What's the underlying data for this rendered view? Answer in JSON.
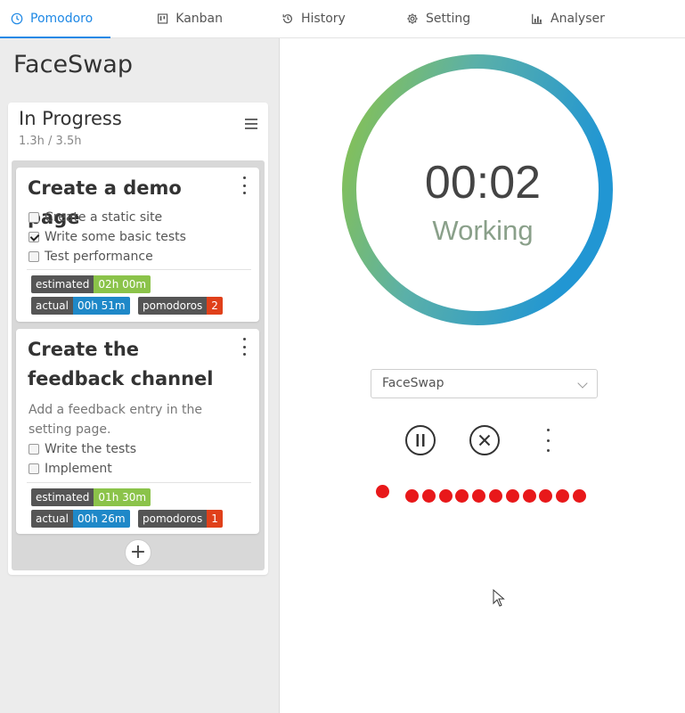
{
  "tabs": [
    {
      "label": "Pomodoro",
      "icon": "clock-icon",
      "active": true
    },
    {
      "label": "Kanban",
      "icon": "kanban-icon",
      "active": false
    },
    {
      "label": "History",
      "icon": "history-icon",
      "active": false
    },
    {
      "label": "Setting",
      "icon": "gear-icon",
      "active": false
    },
    {
      "label": "Analyser",
      "icon": "bar-chart-icon",
      "active": false
    }
  ],
  "project": {
    "title": "FaceSwap"
  },
  "column": {
    "title": "In Progress",
    "subtitle": "1.3h / 3.5h",
    "menu_icon": "hamburger-icon",
    "add_label": "+"
  },
  "cards": [
    {
      "title": "Create a demo page",
      "description": "",
      "tasks": [
        {
          "label": "Create a static site",
          "checked": false
        },
        {
          "label": "Write some basic tests",
          "checked": true
        },
        {
          "label": "Test performance",
          "checked": false
        }
      ],
      "estimated_label": "estimated",
      "estimated_value": "02h 00m",
      "actual_label": "actual",
      "actual_value": "00h 51m",
      "pomodoros_label": "pomodoros",
      "pomodoros_value": "2"
    },
    {
      "title": "Create the feedback channel",
      "description": "Add a feedback entry in the setting page.",
      "tasks": [
        {
          "label": "Write the tests",
          "checked": false
        },
        {
          "label": "Implement",
          "checked": false
        }
      ],
      "estimated_label": "estimated",
      "estimated_value": "01h 30m",
      "actual_label": "actual",
      "actual_value": "00h 26m",
      "pomodoros_label": "pomodoros",
      "pomodoros_value": "1"
    }
  ],
  "timer": {
    "time": "00:02",
    "status": "Working",
    "ring_colors": {
      "start": "#8bc34a",
      "end": "#2196d3"
    },
    "ring_progress": 1.0
  },
  "selector": {
    "value": "FaceSwap"
  },
  "controls": {
    "pause_icon": "pause-icon",
    "cancel_icon": "cancel-icon",
    "more_icon": "more-vertical-icon"
  },
  "pomodoro_dots": {
    "current": 1,
    "remaining": 11,
    "color": "#e8181a"
  },
  "colors": {
    "accent": "#1e88e5",
    "badge_green": "#8bc34a",
    "badge_blue": "#1e88c8",
    "badge_red": "#e0401a"
  }
}
